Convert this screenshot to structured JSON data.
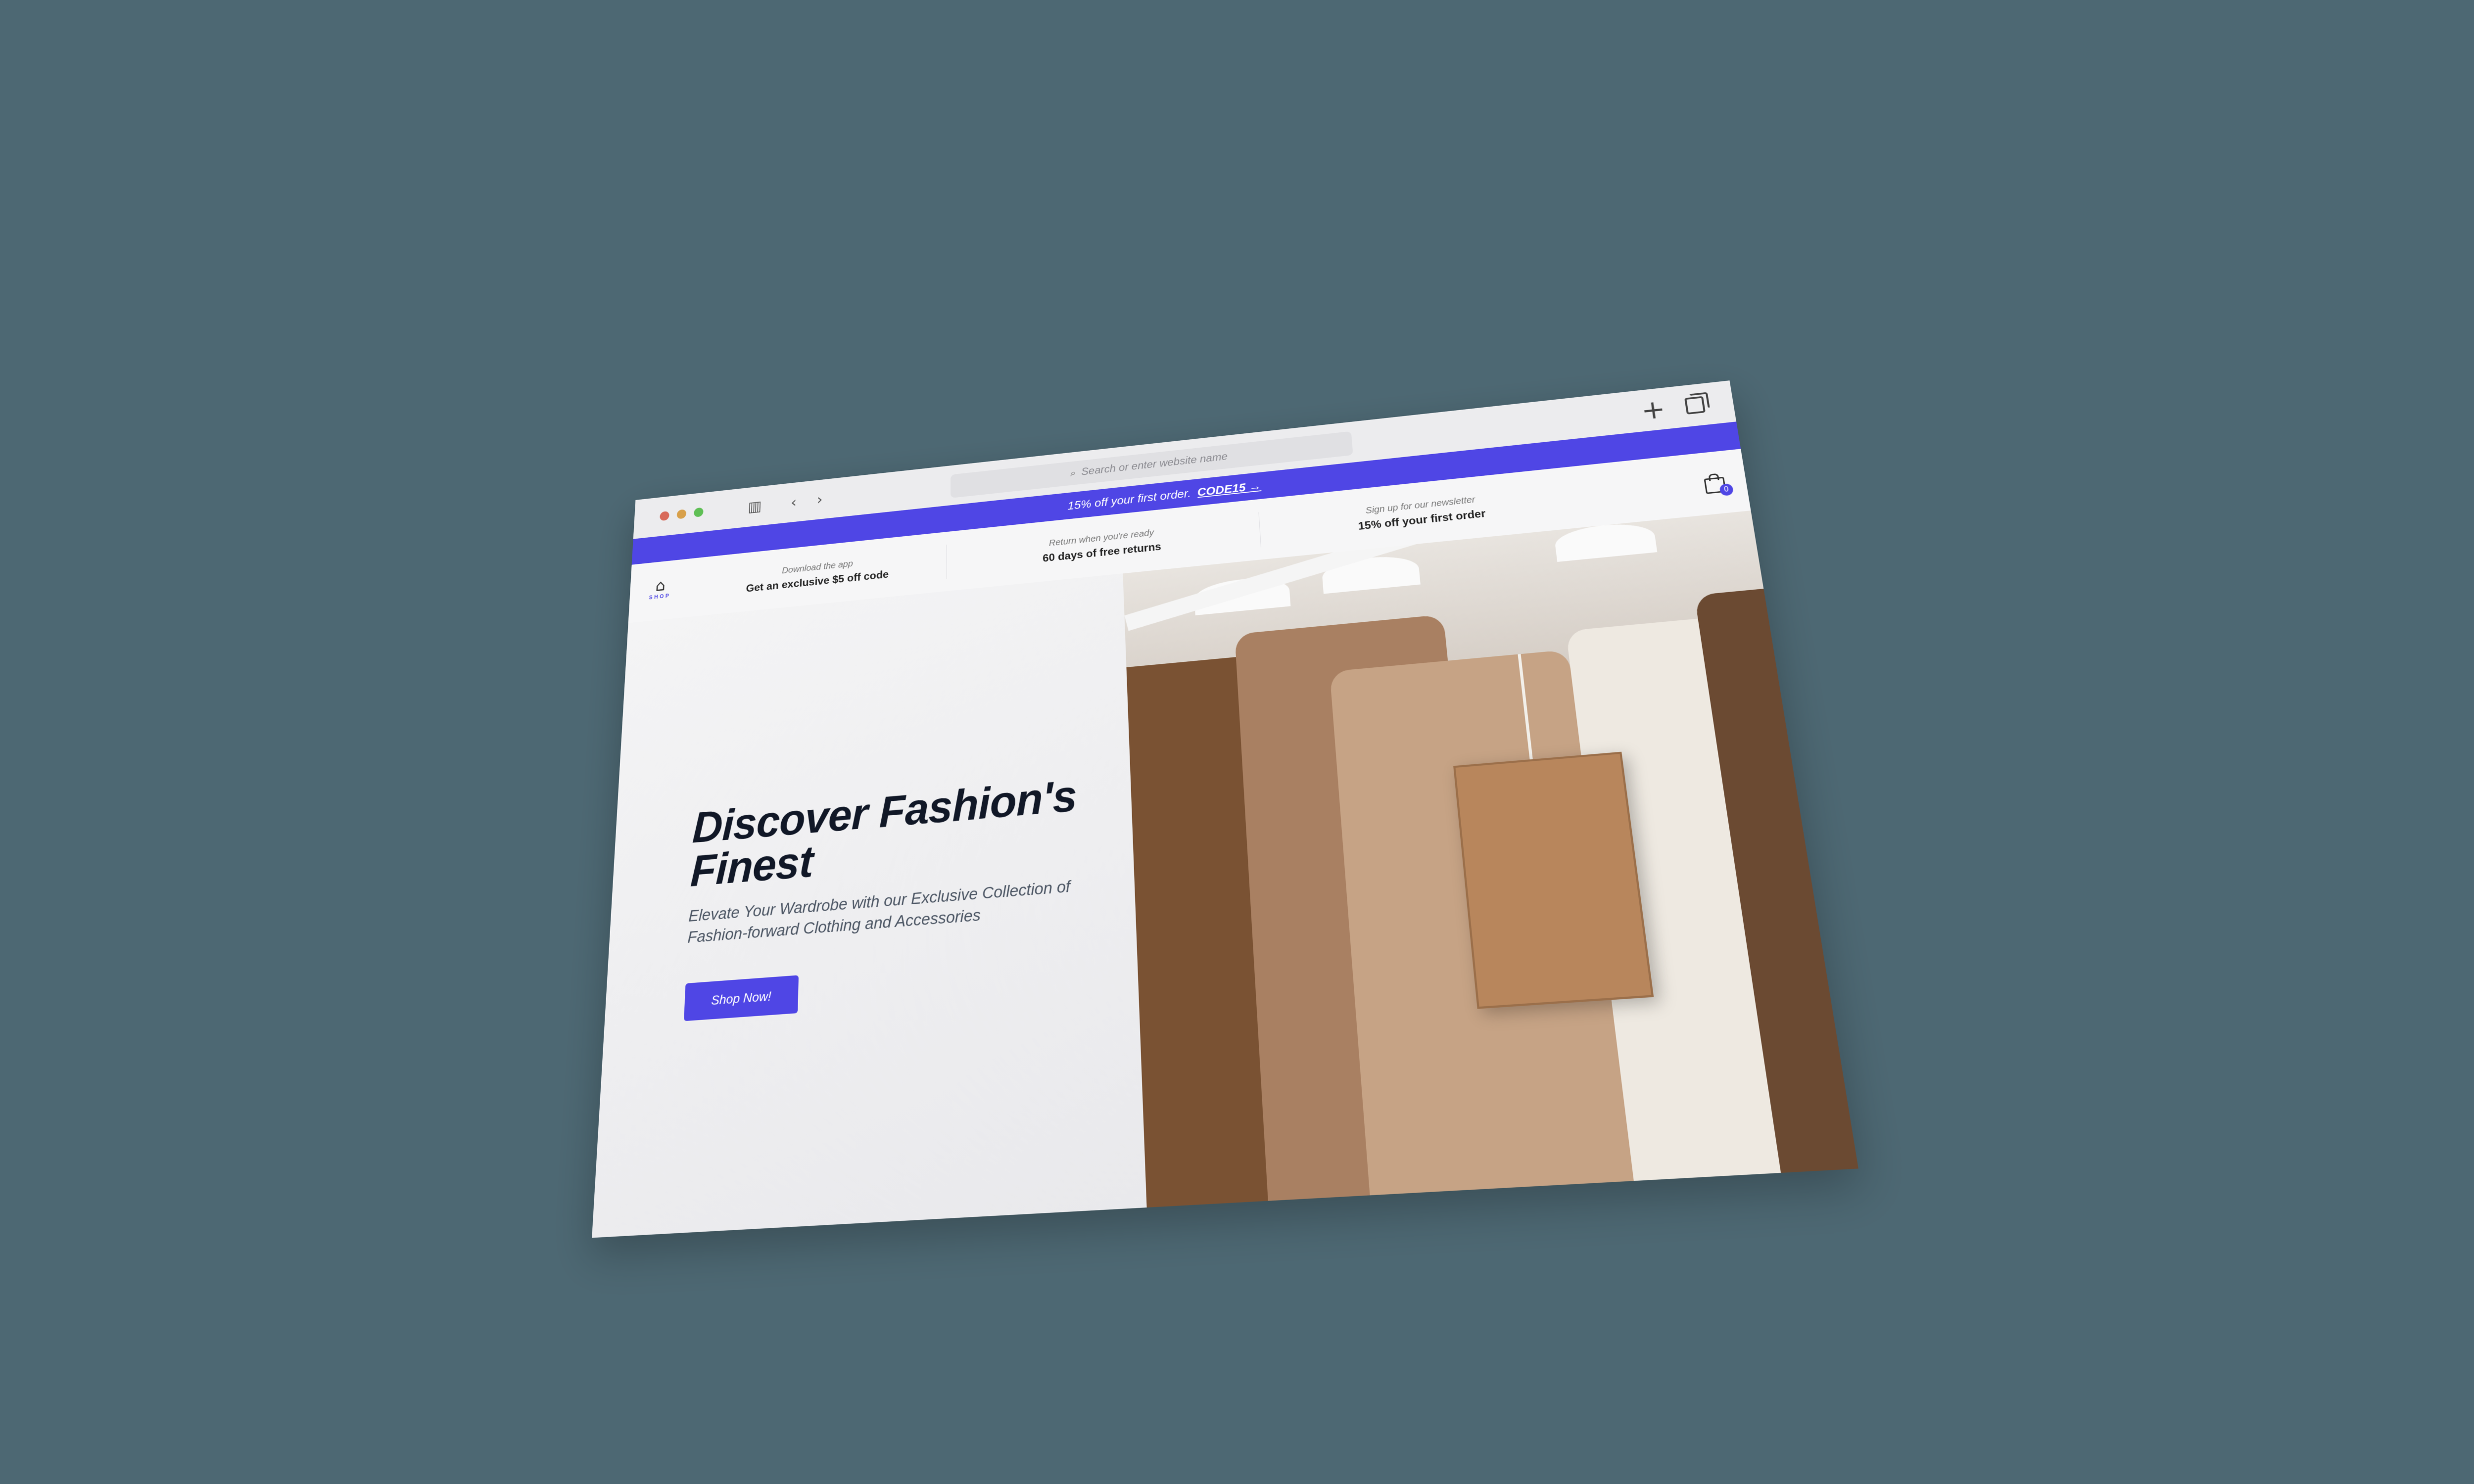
{
  "browser": {
    "address_placeholder": "Search or enter website name",
    "icons": {
      "sidebar": "sidebar-icon",
      "back": "chevron-left-icon",
      "forward": "chevron-right-icon",
      "new_tab": "plus-icon",
      "tabs": "tabs-overview-icon",
      "search": "search-icon"
    }
  },
  "promo": {
    "text": "15% off your first order.",
    "code": "CODE15 →"
  },
  "infobar": {
    "logo": {
      "text": "FASHION",
      "sub": "SHOP"
    },
    "items": [
      {
        "small": "Download the app",
        "big": "Get an exclusive $5 off code"
      },
      {
        "small": "Return when you're ready",
        "big": "60 days of free returns"
      },
      {
        "small": "Sign up for our newsletter",
        "big": "15% off your first order"
      }
    ],
    "cart_count": "0"
  },
  "hero": {
    "title": "Discover Fashion's Finest",
    "subtitle": "Elevate Your Wardrobe with our Exclusive Collection of Fashion-forward Clothing and Accessories",
    "cta": "Shop Now!"
  },
  "colors": {
    "background": "#4d6873",
    "accent": "#4f46e5",
    "title": "#111827"
  }
}
